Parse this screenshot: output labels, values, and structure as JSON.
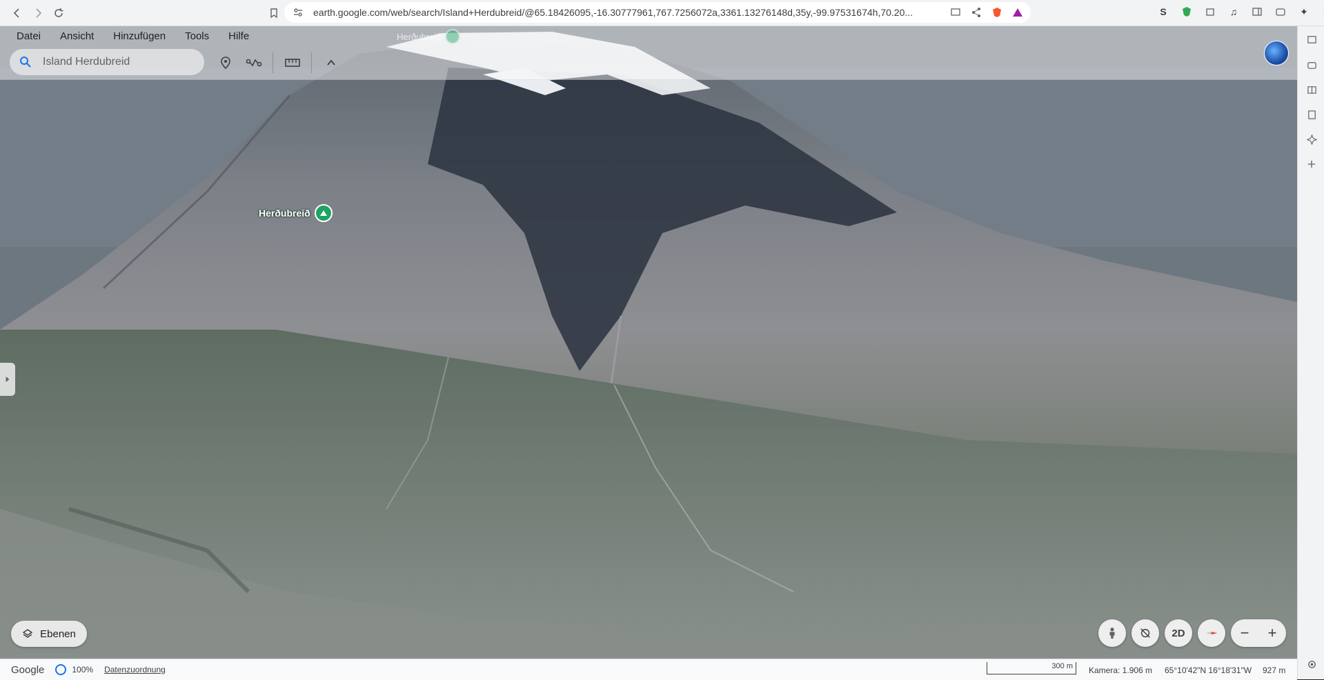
{
  "browser": {
    "url": "earth.google.com/web/search/Island+Herdubreid/@65.18426095,-16.30777961,767.7256072a,3361.13276148d,35y,-99.97531674h,70.20..."
  },
  "menu": {
    "items": [
      "Datei",
      "Ansicht",
      "Hinzufügen",
      "Tools",
      "Hilfe"
    ]
  },
  "search": {
    "value": "Island Herdubreid"
  },
  "toolbar": {
    "icons": [
      "placemark-icon",
      "path-icon",
      "ruler-icon",
      "chevron-up-icon"
    ]
  },
  "map": {
    "placemark_label": "Herðubreið",
    "ghost_placemark_label": "Herðubreið",
    "colors": {
      "placemark": "#1ea362",
      "snow": "#f2f4f6"
    }
  },
  "controls": {
    "layers_label": "Ebenen",
    "mode_label": "2D",
    "zoom_out": "−",
    "zoom_in": "+"
  },
  "status": {
    "logo": "Google",
    "progress": "100%",
    "attribution_label": "Datenzuordnung",
    "scale_label": "300 m",
    "camera": "Kamera: 1.906 m",
    "coordinates": "65°10'42\"N 16°18'31\"W",
    "elevation": "927 m"
  }
}
